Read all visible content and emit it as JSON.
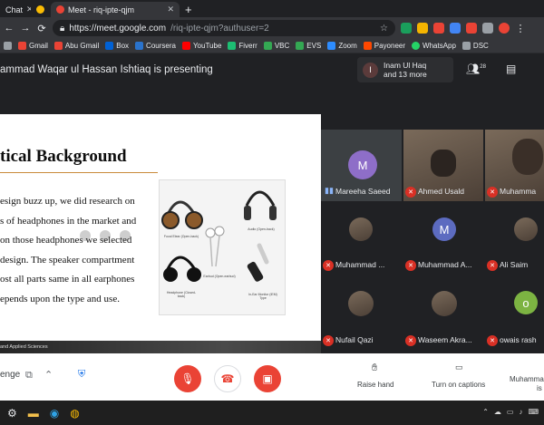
{
  "browser": {
    "tabs": [
      {
        "label": "Chat",
        "active": false
      },
      {
        "label": "",
        "active": false
      },
      {
        "label": "Meet - riq-ipte-qjm",
        "active": true
      }
    ],
    "new_tab_glyph": "+",
    "url_host": "https://meet.google.com",
    "url_path": "/riq-ipte-qjm?authuser=2",
    "bookmarks": [
      "Gmail",
      "Abu Gmail",
      "Box",
      "Coursera",
      "YouTube",
      "Fiverr",
      "VBC",
      "EVS",
      "Zoom",
      "Payoneer",
      "WhatsApp",
      "DSC"
    ],
    "icons": [
      "back-icon",
      "forward-icon",
      "reload-icon",
      "lock-icon",
      "star-icon",
      "menu-icon"
    ]
  },
  "meet": {
    "presenting_text": "ammad Waqar ul Hassan Ishtiaq is presenting",
    "host": {
      "initial": "I",
      "name": "Inam Ul Haq",
      "more": "and 13 more"
    },
    "participant_count": "28"
  },
  "slide": {
    "title": "tical Background",
    "body_lines": [
      "esign buzz up, we did research on",
      "s of headphones in the market and",
      "on those headphones we selected",
      "design. The speaker compartment",
      "ost all parts same in all earphones",
      "epends upon the type and use."
    ],
    "image_captions": [
      "Focal Elear (Open-back)",
      "Audio (Open-back)",
      "Earbud (Open-earbud)",
      "Headphone (Closed-back)",
      "In-Ear Monitor (IEM) Type"
    ],
    "footer": "and Applied Sciences"
  },
  "participants": [
    {
      "name": "Mareeha Saeed",
      "initial": "M",
      "color": "#8e6ec8",
      "muted": false,
      "photo": false
    },
    {
      "name": "Ahmed Usald",
      "initial": "",
      "color": "",
      "muted": true,
      "photo": true
    },
    {
      "name": "Muhamma",
      "initial": "",
      "color": "",
      "muted": true,
      "photo": true
    },
    {
      "name": "Muhammad ...",
      "initial": "",
      "color": "",
      "muted": true,
      "photo": true
    },
    {
      "name": "Muhammad A...",
      "initial": "M",
      "color": "#5c6bc0",
      "muted": true,
      "photo": false
    },
    {
      "name": "Ali Saim",
      "initial": "",
      "color": "",
      "muted": true,
      "photo": true
    },
    {
      "name": "Nufail Qazi",
      "initial": "",
      "color": "",
      "muted": true,
      "photo": true
    },
    {
      "name": "Waseem Akra...",
      "initial": "",
      "color": "",
      "muted": true,
      "photo": true
    },
    {
      "name": "owais rash",
      "initial": "O",
      "color": "#7cb342",
      "muted": true,
      "photo": false
    }
  ],
  "controls": {
    "meet_code": "enge",
    "raise_hand": "Raise hand",
    "captions": "Turn on captions",
    "presenter": "Muhamma",
    "presenter_line2": "is"
  },
  "colors": {
    "accent_red": "#ea4335",
    "meet_bg": "#202124",
    "tile_bg": "#3c4043"
  }
}
